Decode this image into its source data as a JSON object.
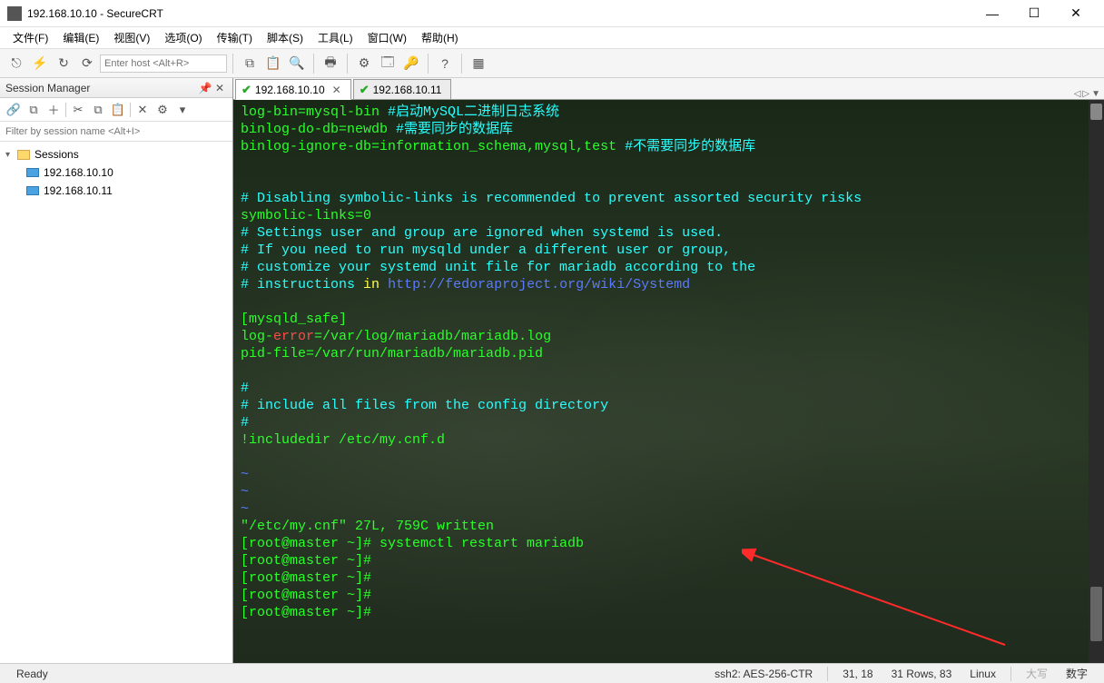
{
  "window": {
    "title": "192.168.10.10 - SecureCRT"
  },
  "menu": {
    "file": "文件(F)",
    "edit": "编辑(E)",
    "view": "视图(V)",
    "options": "选项(O)",
    "transfer": "传输(T)",
    "script": "脚本(S)",
    "tools": "工具(L)",
    "window": "窗口(W)",
    "help": "帮助(H)"
  },
  "toolbar": {
    "host_placeholder": "Enter host <Alt+R>"
  },
  "sessionManager": {
    "title": "Session Manager",
    "filter_placeholder": "Filter by session name <Alt+I>",
    "root": "Sessions",
    "items": [
      "192.168.10.10",
      "192.168.10.11"
    ]
  },
  "tabs": [
    {
      "label": "192.168.10.10",
      "active": true
    },
    {
      "label": "192.168.10.11",
      "active": false
    }
  ],
  "terminal": {
    "lines": [
      {
        "segs": [
          {
            "c": "green",
            "t": "log-bin=mysql-bin "
          },
          {
            "c": "cyan",
            "t": "#启动MySQL二进制日志系统"
          }
        ]
      },
      {
        "segs": [
          {
            "c": "green",
            "t": "binlog-do-db=newdb "
          },
          {
            "c": "cyan",
            "t": "#需要同步的数据库"
          }
        ]
      },
      {
        "segs": [
          {
            "c": "green",
            "t": "binlog-ignore-db=information_schema,mysql,test "
          },
          {
            "c": "cyan",
            "t": "#不需要同步的数据库"
          }
        ]
      },
      {
        "segs": []
      },
      {
        "segs": []
      },
      {
        "segs": [
          {
            "c": "cyan",
            "t": "# Disabling symbolic-links is recommended to prevent assorted security risks"
          }
        ]
      },
      {
        "segs": [
          {
            "c": "green",
            "t": "symbolic-links=0"
          }
        ]
      },
      {
        "segs": [
          {
            "c": "cyan",
            "t": "# Settings user and group are ignored when systemd is used."
          }
        ]
      },
      {
        "segs": [
          {
            "c": "cyan",
            "t": "# If you need to run mysqld under a different user or group,"
          }
        ]
      },
      {
        "segs": [
          {
            "c": "cyan",
            "t": "# customize your systemd unit file for mariadb according to the"
          }
        ]
      },
      {
        "segs": [
          {
            "c": "cyan",
            "t": "# instructions "
          },
          {
            "c": "yellow",
            "t": "in"
          },
          {
            "c": "cyan",
            "t": " "
          },
          {
            "c": "blue",
            "t": "http://fedoraproject.org/wiki/Systemd"
          }
        ]
      },
      {
        "segs": []
      },
      {
        "segs": [
          {
            "c": "green",
            "t": "[mysqld_safe]"
          }
        ]
      },
      {
        "segs": [
          {
            "c": "green",
            "t": "log-"
          },
          {
            "c": "red",
            "t": "error"
          },
          {
            "c": "green",
            "t": "=/var/log/mariadb/mariadb.log"
          }
        ]
      },
      {
        "segs": [
          {
            "c": "green",
            "t": "pid-file=/var/run/mariadb/mariadb.pid"
          }
        ]
      },
      {
        "segs": []
      },
      {
        "segs": [
          {
            "c": "cyan",
            "t": "#"
          }
        ]
      },
      {
        "segs": [
          {
            "c": "cyan",
            "t": "# include all files from the config directory"
          }
        ]
      },
      {
        "segs": [
          {
            "c": "cyan",
            "t": "#"
          }
        ]
      },
      {
        "segs": [
          {
            "c": "green",
            "t": "!includedir /etc/my.cnf.d"
          }
        ]
      },
      {
        "segs": []
      },
      {
        "segs": [
          {
            "c": "blue",
            "t": "~"
          }
        ]
      },
      {
        "segs": [
          {
            "c": "blue",
            "t": "~"
          }
        ]
      },
      {
        "segs": [
          {
            "c": "blue",
            "t": "~"
          }
        ]
      },
      {
        "segs": [
          {
            "c": "green",
            "t": "\"/etc/my.cnf\" 27L, 759C written"
          }
        ]
      },
      {
        "segs": [
          {
            "c": "green",
            "t": "[root@master ~]# systemctl restart mariadb"
          }
        ]
      },
      {
        "segs": [
          {
            "c": "green",
            "t": "[root@master ~]#"
          }
        ]
      },
      {
        "segs": [
          {
            "c": "green",
            "t": "[root@master ~]#"
          }
        ]
      },
      {
        "segs": [
          {
            "c": "green",
            "t": "[root@master ~]#"
          }
        ]
      },
      {
        "segs": [
          {
            "c": "green",
            "t": "[root@master ~]#"
          }
        ]
      }
    ]
  },
  "status": {
    "ready": "Ready",
    "conn": "ssh2: AES-256-CTR",
    "pos": "31, 18",
    "size": "31 Rows, 83",
    "os": "Linux",
    "caps": "大写",
    "num": "数字"
  }
}
